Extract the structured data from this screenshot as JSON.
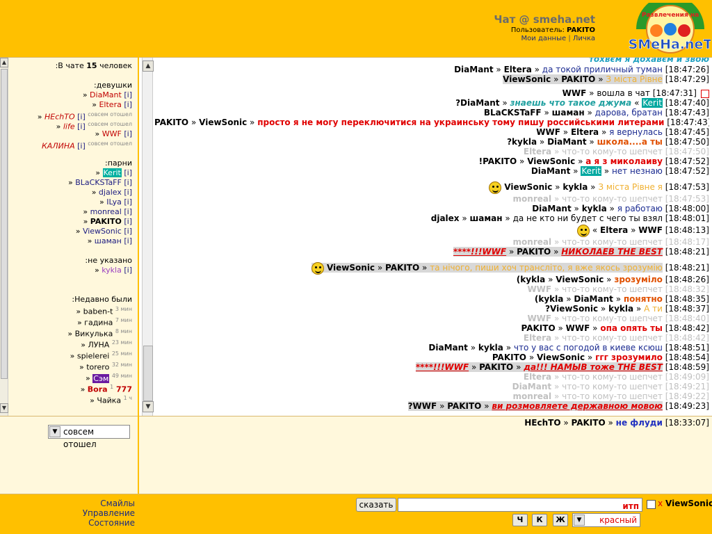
{
  "header": {
    "title": "Чат @ smeha.net",
    "user_label": "Пользователь:",
    "user_name": "PAKITO",
    "link_my_data": "Мои данные",
    "link_sep": "|",
    "link_private": "Личка",
    "logo_top": "Развлечения на",
    "logo_bottom": "SMeHa.neT"
  },
  "users": {
    "count_prefix": "В чате",
    "count": "15",
    "count_suffix": "человек:",
    "girls_label": "девушки:",
    "guys_label": "парни:",
    "unknown_label": "не указано:",
    "recent_label": "Недавно были:",
    "girls": [
      {
        "nick": "DiaMant",
        "extra": "",
        "away": ""
      },
      {
        "nick": "Eltera",
        "extra": "",
        "away": ""
      },
      {
        "nick": "HEchTO",
        "extra": "[i]",
        "away": "совсем отошел"
      },
      {
        "nick": "life",
        "extra": "[i]",
        "away": "совсем отошел"
      },
      {
        "nick": "WWF",
        "extra": "",
        "away": ""
      },
      {
        "nick": "КАЛИНА",
        "extra": "[i]",
        "away": "совсем отошел"
      }
    ],
    "guys": [
      {
        "nick": "Kerit"
      },
      {
        "nick": "BLaCKSTaFF"
      },
      {
        "nick": "djalex"
      },
      {
        "nick": "ILya"
      },
      {
        "nick": "monreal"
      },
      {
        "nick": "PAKITO"
      },
      {
        "nick": "ViewSonic"
      },
      {
        "nick": "шаман"
      }
    ],
    "unknown": [
      {
        "nick": "kykla"
      }
    ],
    "recent": [
      {
        "nick": "baben-t",
        "ago": "3 мин"
      },
      {
        "nick": "гадина",
        "ago": "7 мин"
      },
      {
        "nick": "Викулька",
        "ago": "8 мин"
      },
      {
        "nick": "ЛУНА",
        "ago": "23 мин"
      },
      {
        "nick": "spielerei",
        "ago": "25 мин"
      },
      {
        "nick": "torero",
        "ago": "32 мин"
      },
      {
        "nick": "Сэм",
        "ago": "49 мин"
      },
      {
        "nick": "777 Bora",
        "ago": "1"
      },
      {
        "nick": "Чайка",
        "ago": "1 ч"
      }
    ]
  },
  "messages": [
    {
      "text": "тохвєм я дохавєм и звою",
      "time": ""
    },
    {
      "from": "DiaMant",
      "to": "Eltera",
      "text": "да токой приличный туман",
      "time": "[18:47:26]"
    },
    {
      "from": "ViewSonic",
      "to": "PAKITO",
      "text": "З міста Рівне",
      "time": "[18:47:29]"
    },
    {
      "from": "WWF",
      "text": "вошла в чат",
      "time": "[18:47:31]"
    },
    {
      "from": "?DiaMant",
      "text": "знаешь что такое джума",
      "to": "Kerit",
      "time": "[18:47:40]"
    },
    {
      "from": "BLaCKSTaFF",
      "to": "шаман",
      "text": "дарова, братан",
      "time": "[18:47:43]"
    },
    {
      "from": "PAKITO",
      "to": "ViewSonic",
      "text": "просто я не могу переключитися на украинську тому пишу российськими литерами",
      "time": "[18:47:43]"
    },
    {
      "from": "WWF",
      "to": "Eltera",
      "text": "я вернулась",
      "time": "[18:47:45]"
    },
    {
      "from": "?kykla",
      "to": "DiaMant",
      "text": "школа....а ты",
      "time": "[18:47:50]"
    },
    {
      "from": "Eltera",
      "text": "что-то кому-то шепчет",
      "time": "[18:47:50]"
    },
    {
      "from": "!PAKITO",
      "to": "ViewSonic",
      "text": "а я з миколаиву",
      "time": "[18:47:52]"
    },
    {
      "from": "DiaMant",
      "to": "Kerit",
      "text": "нет незнаю",
      "time": "[18:47:52]"
    },
    {
      "from": "ViewSonic",
      "to": "kykla",
      "text": "З міста Рівне я",
      "time": "[18:47:53]"
    },
    {
      "from": "monreal",
      "text": "что-то кому-то шепчет",
      "time": "[18:47:53]"
    },
    {
      "from": "DiaMant",
      "to": "kykla",
      "text": "я работаю",
      "time": "[18:48:00]"
    },
    {
      "from": "djalex",
      "to": "шаман",
      "text": "да не кто ни будет с чего ты взял",
      "time": "[18:48:01]"
    },
    {
      "from": "Eltera",
      "to": "WWF",
      "text": "",
      "time": "[18:48:13]"
    },
    {
      "from": "monreal",
      "text": "что-то кому-то шепчет",
      "time": "[18:48:17]"
    },
    {
      "from": "****!!!WWF",
      "to": "PAKITO",
      "text": "НИКОЛАЕВ THE BEST",
      "time": "[18:48:21]"
    },
    {
      "from": "ViewSonic",
      "to": "PAKITO",
      "text": "та нічого, пиши хоч трансліто, я вже якось зрозумію",
      "time": "[18:48:21]"
    },
    {
      "from": "(kykla",
      "to": "ViewSonic",
      "text": "зрозуміло",
      "time": "[18:48:26]"
    },
    {
      "from": "WWF",
      "text": "что-то кому-то шепчет",
      "time": "[18:48:32]"
    },
    {
      "from": "(kykla",
      "to": "DiaMant",
      "text": "понятно",
      "time": "[18:48:35]"
    },
    {
      "from": "?ViewSonic",
      "to": "kykla",
      "text": "А ти",
      "time": "[18:48:37]"
    },
    {
      "from": "WWF",
      "text": "что-то кому-то шепчет",
      "time": "[18:48:40]"
    },
    {
      "from": "PAKITO",
      "to": "WWF",
      "text": "опа опять ты",
      "time": "[18:48:42]"
    },
    {
      "from": "Eltera",
      "text": "что-то кому-то шепчет",
      "time": "[18:48:42]"
    },
    {
      "from": "DiaMant",
      "to": "kykla",
      "text": "что у вас с погодой в киеве ксюш",
      "time": "[18:48:51]"
    },
    {
      "from": "PAKITO",
      "to": "ViewSonic",
      "text": "ггг зрозумило",
      "time": "[18:48:54]"
    },
    {
      "from": "****!!!WWF",
      "to": "PAKITO",
      "text": "да!!! НАМЫВ тоже THE BEST",
      "time": "[18:48:59]"
    },
    {
      "from": "Eltera",
      "text": "что-то кому-то шепчет",
      "time": "[18:49:09]"
    },
    {
      "from": "DiaMant",
      "text": "что-то кому-то шепчет",
      "time": "[18:49:21]"
    },
    {
      "from": "monreal",
      "text": "что-то кому-то шепчет",
      "time": "[18:49:22]"
    },
    {
      "from": "?WWF",
      "to": "PAKITO",
      "text": "ви розмовляете державною мовою",
      "time": "[18:49:23]"
    }
  ],
  "private": {
    "from": "HEchTO",
    "to": "PAKITO",
    "text": "не флуди",
    "time": "[18:33:07]"
  },
  "status": {
    "value": "совсем отошел"
  },
  "footer": {
    "smiles": "Смайлы",
    "manage": "Управление",
    "state": "Состояние",
    "say": "сказать",
    "input_hint": "итп",
    "to_x": "x",
    "to_nick": "ViewSonic",
    "bold": "Ж",
    "italic": "К",
    "underline": "Ч",
    "color": "красный"
  },
  "symbols": {
    "arrow": "»",
    "left_quote": "«",
    "open_bracket": "[",
    "up": "▲",
    "down": "▼",
    "sel": "▼"
  }
}
